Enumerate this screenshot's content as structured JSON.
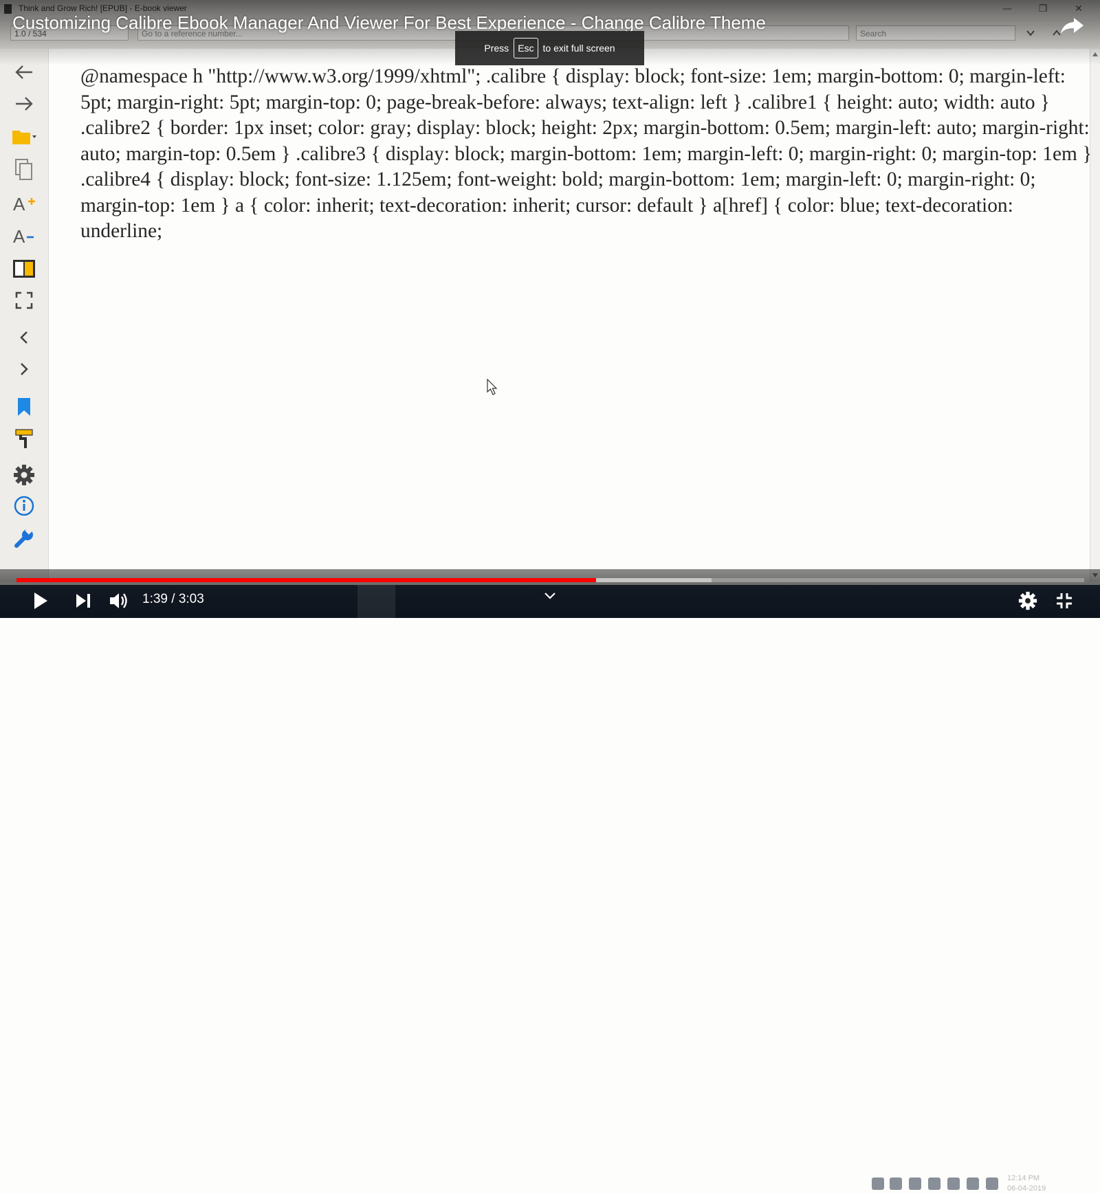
{
  "window": {
    "title": "Think and Grow Rich! [EPUB] - E-book viewer",
    "minimize_glyph": "—",
    "restore_glyph": "❐",
    "close_glyph": "✕"
  },
  "toolbar": {
    "position_value": "1.0 / 534",
    "reference_placeholder": "Go to a reference number...",
    "search_placeholder": "Search"
  },
  "video": {
    "title": "Customizing Calibre Ebook Manager And Viewer For Best Experience - Change Calibre Theme",
    "fullscreen_prompt_before": "Press",
    "fullscreen_key": "Esc",
    "fullscreen_prompt_after": "to exit full screen",
    "current_time": "1:39",
    "time_separator": " / ",
    "duration": "3:03",
    "played_fraction": 0.5425,
    "buffered_fraction": 0.6507
  },
  "sidebar": {
    "icons": [
      "back-arrow",
      "forward-arrow",
      "folder-open",
      "copy",
      "font-larger",
      "font-smaller",
      "toggle-toc",
      "fullscreen",
      "previous-page",
      "next-page",
      "bookmark",
      "reference-mode",
      "preferences-gear",
      "metadata-info",
      "inspector-wrench"
    ]
  },
  "document": {
    "text": "@namespace h \"http://www.w3.org/1999/xhtml\"; .calibre { display: block; font-size: 1em; margin-bottom: 0; margin-left: 5pt; margin-right: 5pt; margin-top: 0; page-break-before: always; text-align: left } .calibre1 { height: auto; width: auto } .calibre2 { border: 1px inset; color: gray; display: block; height: 2px; margin-bottom: 0.5em; margin-left: auto; margin-right: auto; margin-top: 0.5em } .calibre3 { display: block; margin-bottom: 1em; margin-left: 0; margin-right: 0; margin-top: 1em } .calibre4 { display: block; font-size: 1.125em; font-weight: bold; margin-bottom: 1em; margin-left: 0; margin-right: 0; margin-top: 1em } a { color: inherit; text-decoration: inherit; cursor: default } a[href] { color: blue; text-decoration: underline;"
  },
  "taskbar": {
    "clock_time": "12:14 PM",
    "clock_date": "06-04-2019"
  },
  "colors": {
    "progress_played": "#ff0000",
    "folder_icon": "#f6b800",
    "bookmark_icon": "#1e88e5",
    "info_icon": "#1976d2",
    "wrench_icon": "#1e73d8"
  }
}
